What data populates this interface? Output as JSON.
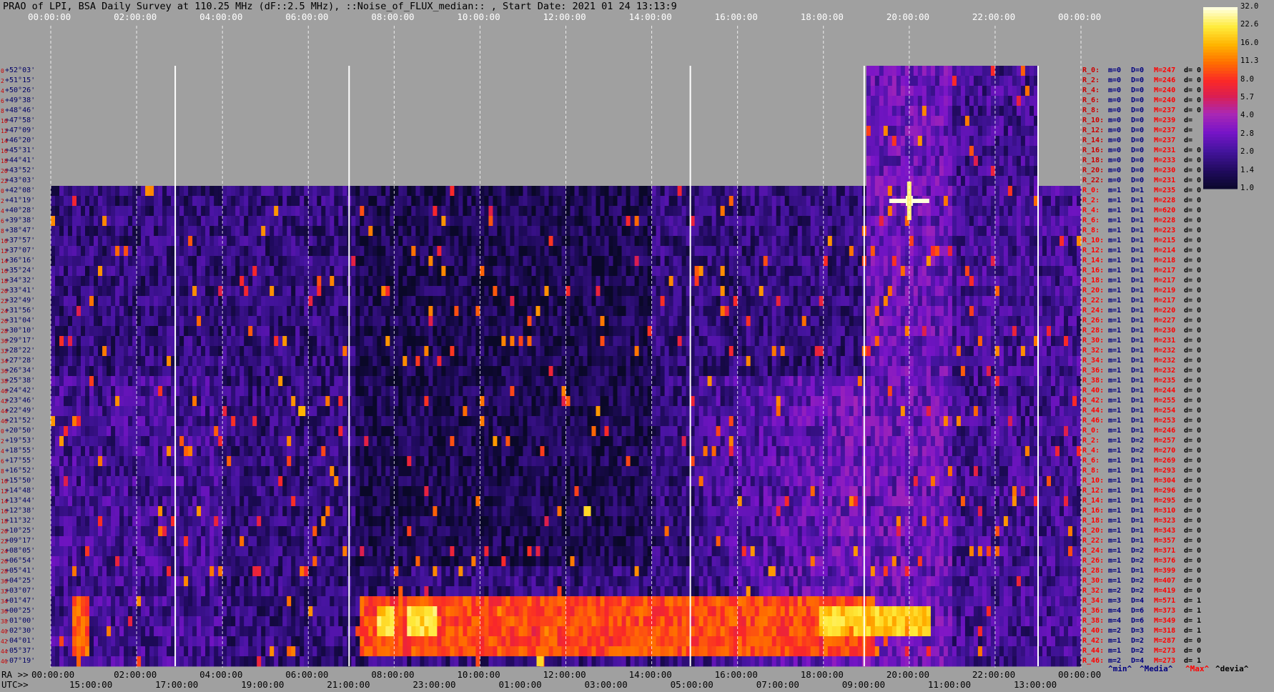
{
  "header": {
    "title": "PRAO of LPI, BSA Daily Survey at 110.25 MHz (dF::2.5 MHz), ::Noise_of_FLUX_median:: , Start Date: 2021 01 24 13:13:9"
  },
  "axes": {
    "utc_ticks": [
      "00:00:00",
      "02:00:00",
      "04:00:00",
      "06:00:00",
      "08:00:00",
      "10:00:00",
      "12:00:00",
      "14:00:00",
      "16:00:00",
      "18:00:00",
      "20:00:00",
      "22:00:00",
      "00:00:00"
    ],
    "ra_prefix": "RA >>",
    "utc_prefix": "UTC>>",
    "lst_ticks": [
      "15:00:00",
      "17:00:00",
      "19:00:00",
      "21:00:00",
      "23:00:00",
      "01:00:00",
      "03:00:00",
      "05:00:00",
      "07:00:00",
      "09:00:00",
      "11:00:00",
      "13:00:00"
    ]
  },
  "declinations": [
    "+52°03'",
    "+51°15'",
    "+50°26'",
    "+49°38'",
    "+48°46'",
    "+47°58'",
    "+47°09'",
    "+46°20'",
    "+45°31'",
    "+44°41'",
    "+43°52'",
    "+43°03'",
    "+42°08'",
    "+41°19'",
    "+40°28'",
    "+39°38'",
    "+38°47'",
    "+37°57'",
    "+37°07'",
    "+36°16'",
    "+35°24'",
    "+34°32'",
    "+33°41'",
    "+32°49'",
    "+31°56'",
    "+31°04'",
    "+30°10'",
    "+29°17'",
    "+28°22'",
    "+27°28'",
    "+26°34'",
    "+25°38'",
    "+24°42'",
    "+23°46'",
    "+22°49'",
    "+21°52'",
    "+20°50'",
    "+19°53'",
    "+18°55'",
    "+17°55'",
    "+16°52'",
    "+15°50'",
    "+14°48'",
    "+13°44'",
    "+12°38'",
    "+11°32'",
    "+10°25'",
    "+09°17'",
    "+08°05'",
    "+06°54'",
    "+05°41'",
    "+04°25'",
    "+03°07'",
    "+01°47'",
    "+00°25'",
    "-01°00'",
    "-02°30'",
    "-04°01'",
    "-05°37'",
    "-07°19'"
  ],
  "beam_numbers": [
    "0",
    "2",
    "4",
    "6",
    "8",
    "10",
    "12",
    "14",
    "16",
    "18",
    "20",
    "22",
    "0",
    "2",
    "4",
    "6",
    "8",
    "10",
    "12",
    "14",
    "16",
    "18",
    "20",
    "22",
    "24",
    "26",
    "28",
    "30",
    "32",
    "34",
    "36",
    "38",
    "40",
    "42",
    "44",
    "46",
    "0",
    "2",
    "4",
    "6",
    "8",
    "10",
    "12",
    "14",
    "16",
    "18",
    "20",
    "22",
    "24",
    "26",
    "28",
    "30",
    "32",
    "34",
    "36",
    "38",
    "40",
    "42",
    "44",
    "46"
  ],
  "stats": [
    {
      "r": "R_0:",
      "m": "m=0",
      "d": "D=0",
      "M": "M=247",
      "dv": "d= 0",
      "t": "b"
    },
    {
      "r": "R_2:",
      "m": "m=0",
      "d": "D=0",
      "M": "M=246",
      "dv": "d= 0",
      "t": "b"
    },
    {
      "r": "R_4:",
      "m": "m=0",
      "d": "D=0",
      "M": "M=240",
      "dv": "d= 0",
      "t": "b"
    },
    {
      "r": "R_6:",
      "m": "m=0",
      "d": "D=0",
      "M": "M=240",
      "dv": "d= 0",
      "t": "b"
    },
    {
      "r": "R_8:",
      "m": "m=0",
      "d": "D=0",
      "M": "M=237",
      "dv": "d= 0",
      "t": "b"
    },
    {
      "r": "R_10:",
      "m": "m=0",
      "d": "D=0",
      "M": "M=239",
      "dv": "d=",
      "t": "b"
    },
    {
      "r": "R_12:",
      "m": "m=0",
      "d": "D=0",
      "M": "M=237",
      "dv": "d=",
      "t": "b"
    },
    {
      "r": "R_14:",
      "m": "m=0",
      "d": "D=0",
      "M": "M=237",
      "dv": "d=",
      "t": "b"
    },
    {
      "r": "R_16:",
      "m": "m=0",
      "d": "D=0",
      "M": "M=231",
      "dv": "d= 0",
      "t": "b"
    },
    {
      "r": "R_18:",
      "m": "m=0",
      "d": "D=0",
      "M": "M=233",
      "dv": "d= 0",
      "t": "b"
    },
    {
      "r": "R_20:",
      "m": "m=0",
      "d": "D=0",
      "M": "M=230",
      "dv": "d= 0",
      "t": "b"
    },
    {
      "r": "R_22:",
      "m": "m=0",
      "d": "D=0",
      "M": "M=231",
      "dv": "d= 0",
      "t": "b"
    },
    {
      "r": "R_0:",
      "m": "m=1",
      "d": "D=1",
      "M": "M=235",
      "dv": "d= 0",
      "t": "r"
    },
    {
      "r": "R_2:",
      "m": "m=1",
      "d": "D=1",
      "M": "M=228",
      "dv": "d= 0",
      "t": "r"
    },
    {
      "r": "R_4:",
      "m": "m=1",
      "d": "D=1",
      "M": "M=620",
      "dv": "d= 0",
      "t": "r"
    },
    {
      "r": "R_6:",
      "m": "m=1",
      "d": "D=1",
      "M": "M=228",
      "dv": "d= 0",
      "t": "r"
    },
    {
      "r": "R_8:",
      "m": "m=1",
      "d": "D=1",
      "M": "M=223",
      "dv": "d= 0",
      "t": "r"
    },
    {
      "r": "R_10:",
      "m": "m=1",
      "d": "D=1",
      "M": "M=215",
      "dv": "d= 0",
      "t": "r"
    },
    {
      "r": "R_12:",
      "m": "m=1",
      "d": "D=1",
      "M": "M=214",
      "dv": "d= 0",
      "t": "r"
    },
    {
      "r": "R_14:",
      "m": "m=1",
      "d": "D=1",
      "M": "M=218",
      "dv": "d= 0",
      "t": "r"
    },
    {
      "r": "R_16:",
      "m": "m=1",
      "d": "D=1",
      "M": "M=217",
      "dv": "d= 0",
      "t": "r"
    },
    {
      "r": "R_18:",
      "m": "m=1",
      "d": "D=1",
      "M": "M=217",
      "dv": "d= 0",
      "t": "r"
    },
    {
      "r": "R_20:",
      "m": "m=1",
      "d": "D=1",
      "M": "M=219",
      "dv": "d= 0",
      "t": "r"
    },
    {
      "r": "R_22:",
      "m": "m=1",
      "d": "D=1",
      "M": "M=217",
      "dv": "d= 0",
      "t": "r"
    },
    {
      "r": "R_24:",
      "m": "m=1",
      "d": "D=1",
      "M": "M=220",
      "dv": "d= 0",
      "t": "r"
    },
    {
      "r": "R_26:",
      "m": "m=1",
      "d": "D=1",
      "M": "M=227",
      "dv": "d= 0",
      "t": "r"
    },
    {
      "r": "R_28:",
      "m": "m=1",
      "d": "D=1",
      "M": "M=230",
      "dv": "d= 0",
      "t": "r"
    },
    {
      "r": "R_30:",
      "m": "m=1",
      "d": "D=1",
      "M": "M=231",
      "dv": "d= 0",
      "t": "r"
    },
    {
      "r": "R_32:",
      "m": "m=1",
      "d": "D=1",
      "M": "M=232",
      "dv": "d= 0",
      "t": "r"
    },
    {
      "r": "R_34:",
      "m": "m=1",
      "d": "D=1",
      "M": "M=232",
      "dv": "d= 0",
      "t": "r"
    },
    {
      "r": "R_36:",
      "m": "m=1",
      "d": "D=1",
      "M": "M=232",
      "dv": "d= 0",
      "t": "r"
    },
    {
      "r": "R_38:",
      "m": "m=1",
      "d": "D=1",
      "M": "M=235",
      "dv": "d= 0",
      "t": "r"
    },
    {
      "r": "R_40:",
      "m": "m=1",
      "d": "D=1",
      "M": "M=244",
      "dv": "d= 0",
      "t": "r"
    },
    {
      "r": "R_42:",
      "m": "m=1",
      "d": "D=1",
      "M": "M=255",
      "dv": "d= 0",
      "t": "r"
    },
    {
      "r": "R_44:",
      "m": "m=1",
      "d": "D=1",
      "M": "M=254",
      "dv": "d= 0",
      "t": "r"
    },
    {
      "r": "R_46:",
      "m": "m=1",
      "d": "D=1",
      "M": "M=253",
      "dv": "d= 0",
      "t": "r"
    },
    {
      "r": "R_0:",
      "m": "m=1",
      "d": "D=1",
      "M": "M=246",
      "dv": "d= 0",
      "t": "r"
    },
    {
      "r": "R_2:",
      "m": "m=1",
      "d": "D=2",
      "M": "M=257",
      "dv": "d= 0",
      "t": "r"
    },
    {
      "r": "R_4:",
      "m": "m=1",
      "d": "D=2",
      "M": "M=270",
      "dv": "d= 0",
      "t": "r"
    },
    {
      "r": "R_6:",
      "m": "m=1",
      "d": "D=1",
      "M": "M=269",
      "dv": "d= 0",
      "t": "r"
    },
    {
      "r": "R_8:",
      "m": "m=1",
      "d": "D=1",
      "M": "M=293",
      "dv": "d= 0",
      "t": "r"
    },
    {
      "r": "R_10:",
      "m": "m=1",
      "d": "D=1",
      "M": "M=304",
      "dv": "d= 0",
      "t": "r"
    },
    {
      "r": "R_12:",
      "m": "m=1",
      "d": "D=1",
      "M": "M=296",
      "dv": "d= 0",
      "t": "r"
    },
    {
      "r": "R_14:",
      "m": "m=1",
      "d": "D=1",
      "M": "M=295",
      "dv": "d= 0",
      "t": "r"
    },
    {
      "r": "R_16:",
      "m": "m=1",
      "d": "D=1",
      "M": "M=310",
      "dv": "d= 0",
      "t": "r"
    },
    {
      "r": "R_18:",
      "m": "m=1",
      "d": "D=1",
      "M": "M=323",
      "dv": "d= 0",
      "t": "r"
    },
    {
      "r": "R_20:",
      "m": "m=1",
      "d": "D=1",
      "M": "M=343",
      "dv": "d= 0",
      "t": "r"
    },
    {
      "r": "R_22:",
      "m": "m=1",
      "d": "D=1",
      "M": "M=357",
      "dv": "d= 0",
      "t": "r"
    },
    {
      "r": "R_24:",
      "m": "m=1",
      "d": "D=2",
      "M": "M=371",
      "dv": "d= 0",
      "t": "r"
    },
    {
      "r": "R_26:",
      "m": "m=1",
      "d": "D=2",
      "M": "M=376",
      "dv": "d= 0",
      "t": "r"
    },
    {
      "r": "R_28:",
      "m": "m=1",
      "d": "D=1",
      "M": "M=399",
      "dv": "d= 0",
      "t": "r"
    },
    {
      "r": "R_30:",
      "m": "m=1",
      "d": "D=2",
      "M": "M=407",
      "dv": "d= 0",
      "t": "r"
    },
    {
      "r": "R_32:",
      "m": "m=2",
      "d": "D=2",
      "M": "M=419",
      "dv": "d= 0",
      "t": "r"
    },
    {
      "r": "R_34:",
      "m": "m=3",
      "d": "D=4",
      "M": "M=571",
      "dv": "d= 1",
      "t": "r"
    },
    {
      "r": "R_36:",
      "m": "m=4",
      "d": "D=6",
      "M": "M=373",
      "dv": "d= 1",
      "t": "r"
    },
    {
      "r": "R_38:",
      "m": "m=4",
      "d": "D=6",
      "M": "M=349",
      "dv": "d= 1",
      "t": "r"
    },
    {
      "r": "R_40:",
      "m": "m=2",
      "d": "D=3",
      "M": "M=318",
      "dv": "d= 1",
      "t": "r"
    },
    {
      "r": "R_42:",
      "m": "m=1",
      "d": "D=2",
      "M": "M=287",
      "dv": "d= 0",
      "t": "r"
    },
    {
      "r": "R_44:",
      "m": "m=1",
      "d": "D=2",
      "M": "M=273",
      "dv": "d= 0",
      "t": "r"
    },
    {
      "r": "R_46:",
      "m": "m=2",
      "d": "D=4",
      "M": "M=273",
      "dv": "d= 1",
      "t": "r"
    }
  ],
  "footer": {
    "min": "^min^",
    "median": "^Media^",
    "max": "^Max^",
    "dev": "^devia^"
  },
  "colorbar": {
    "ticks": [
      "32.0",
      "22.6",
      "16.0",
      "11.3",
      "8.0",
      "5.7",
      "4.0",
      "2.8",
      "2.0",
      "1.4",
      "1.0"
    ]
  },
  "chart_data": {
    "type": "heatmap",
    "title": "PRAO of LPI, BSA Daily Survey at 110.25 MHz (dF::2.5 MHz), ::Noise_of_FLUX_median:: , Start Date: 2021 01 24 13:13:9",
    "xlabel": "",
    "ylabel": "",
    "x_range_hours": [
      0,
      24
    ],
    "colorbar_range": [
      1.0,
      32.0
    ],
    "colorbar_scale": "log",
    "rows": 60,
    "missing": [
      {
        "rows": [
          0,
          11
        ],
        "x_hours": [
          0,
          19.0
        ]
      },
      {
        "rows": [
          0,
          11
        ],
        "x_hours": [
          23.0,
          24.0
        ]
      }
    ],
    "bright_bands": [
      {
        "rows": [
          53,
          58
        ],
        "x_hours": [
          0.5,
          0.9
        ],
        "level": 11
      },
      {
        "rows": [
          53,
          58
        ],
        "x_hours": [
          7.2,
          19.2
        ],
        "level": 10
      },
      {
        "rows": [
          54,
          56
        ],
        "x_hours": [
          7.6,
          8.0
        ],
        "level": 22
      },
      {
        "rows": [
          54,
          56
        ],
        "x_hours": [
          8.3,
          9.0
        ],
        "level": 22
      },
      {
        "rows": [
          54,
          56
        ],
        "x_hours": [
          17.9,
          20.5
        ],
        "level": 20
      }
    ],
    "point_sources": [
      {
        "row": 13,
        "x_hours": 20.0,
        "level": 32
      },
      {
        "row": 44,
        "x_hours": 12.5,
        "level": 20
      },
      {
        "row": 34,
        "x_hours": 5.85,
        "level": 16
      },
      {
        "row": 50,
        "x_hours": 16.8,
        "level": 14
      },
      {
        "row": 59,
        "x_hours": 11.4,
        "level": 20
      }
    ],
    "vertical_lines_hours": [
      2.9,
      6.95,
      14.9,
      18.95,
      23.0
    ]
  }
}
